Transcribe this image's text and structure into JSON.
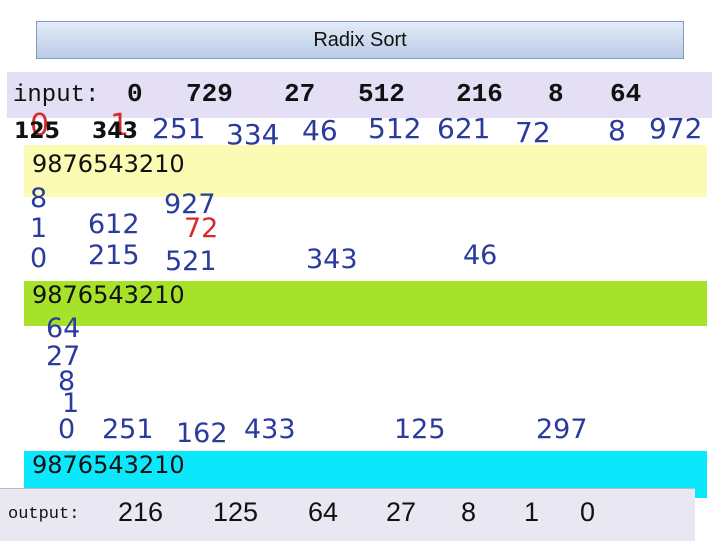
{
  "title": "Radix Sort",
  "input": {
    "label": "input:",
    "values": [
      "0",
      "729",
      "27",
      "512",
      "216",
      "8",
      "64"
    ]
  },
  "radix_row_label": "9876543210",
  "pass1": {
    "row": [
      {
        "main": "125",
        "overlay": "0"
      },
      {
        "main": "343",
        "overlay": "1"
      },
      {
        "main": "251",
        "overlay": "1"
      },
      {
        "main": "334"
      },
      {
        "main": "46"
      },
      {
        "main": "512"
      },
      {
        "main": "621"
      },
      {
        "main": "72"
      },
      {
        "main": "8"
      },
      {
        "main": "972"
      }
    ]
  },
  "buckets1": {
    "col0": [
      "8",
      "1",
      "0"
    ],
    "items": [
      "612",
      "215",
      "521",
      "927",
      "72",
      "343",
      "46"
    ]
  },
  "buckets2": {
    "col0": [
      "64",
      "27",
      "8",
      "1",
      "0"
    ],
    "items": [
      "251",
      "162",
      "433",
      "125",
      "297"
    ]
  },
  "output": {
    "label": "output:",
    "values": [
      "216",
      "125",
      "64",
      "27",
      "8",
      "1",
      "0"
    ]
  }
}
